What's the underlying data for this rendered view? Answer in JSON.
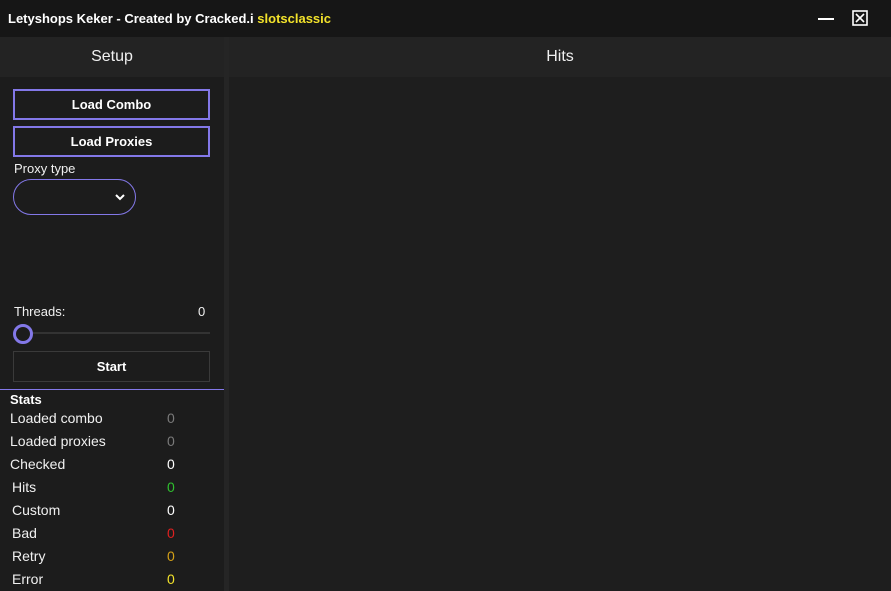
{
  "window": {
    "title_main": "Letyshops Keker - Created by Cracked.i",
    "title_user": "slotsclassic"
  },
  "setup": {
    "header": "Setup",
    "load_combo_label": "Load Combo",
    "load_proxies_label": "Load Proxies",
    "proxy_type_label": "Proxy type",
    "proxy_type_value": "",
    "threads_label": "Threads:",
    "threads_value": "0",
    "threads_fraction": 0,
    "start_label": "Start"
  },
  "hits": {
    "header": "Hits"
  },
  "stats": {
    "title": "Stats",
    "items": [
      {
        "label": "Loaded combo",
        "value": "0",
        "color": "#7a7a7a"
      },
      {
        "label": "Loaded proxies",
        "value": "0",
        "color": "#7a7a7a"
      },
      {
        "label": "Checked",
        "value": "0",
        "color": "#ffffff"
      },
      {
        "label": "Hits",
        "value": "0",
        "color": "#2fbf2f"
      },
      {
        "label": "Custom",
        "value": "0",
        "color": "#ffffff"
      },
      {
        "label": "Bad",
        "value": "0",
        "color": "#e02020"
      },
      {
        "label": "Retry",
        "value": "0",
        "color": "#d4a017"
      },
      {
        "label": "Error",
        "value": "0",
        "color": "#f2e22b"
      }
    ]
  },
  "colors": {
    "accent": "#8378e8"
  }
}
